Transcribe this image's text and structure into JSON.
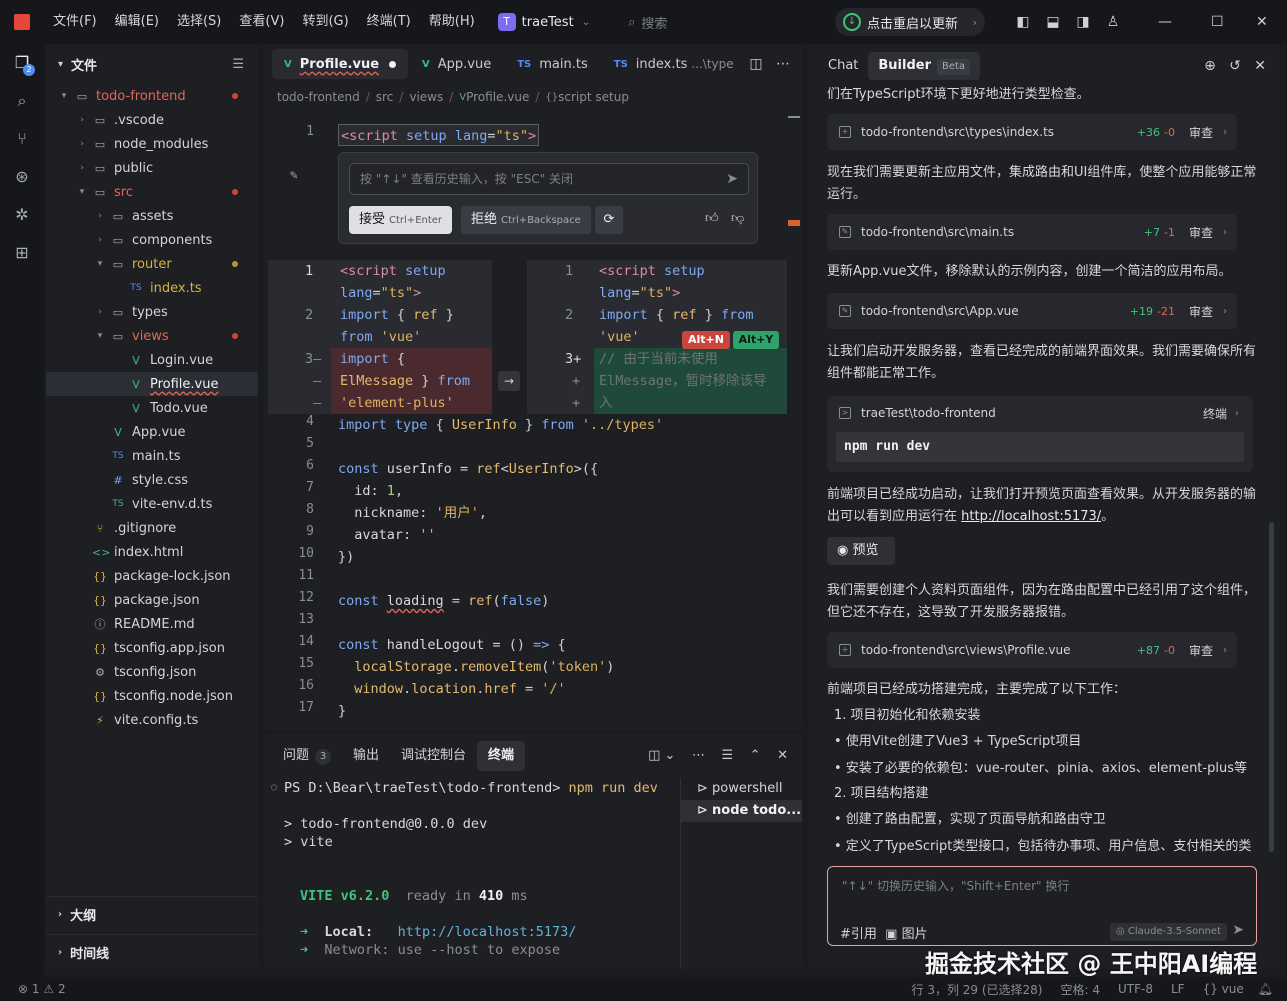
{
  "titlebar": {
    "menu": [
      "文件(F)",
      "编辑(E)",
      "选择(S)",
      "查看(V)",
      "转到(G)",
      "终端(T)",
      "帮助(H)"
    ],
    "project_badge": "T",
    "project_name": "traeTest",
    "search_placeholder": "搜索",
    "update_label": "点击重启以更新"
  },
  "activity": {
    "badge": "2"
  },
  "explorer": {
    "title": "文件",
    "tree": [
      {
        "label": "todo-frontend",
        "icon": "folder-open",
        "depth": 0,
        "tw": "▾",
        "color": "red",
        "dot": "#c9463d"
      },
      {
        "label": ".vscode",
        "icon": "folder",
        "depth": 1,
        "tw": "›"
      },
      {
        "label": "node_modules",
        "icon": "folder",
        "depth": 1,
        "tw": "›"
      },
      {
        "label": "public",
        "icon": "folder",
        "depth": 1,
        "tw": "›"
      },
      {
        "label": "src",
        "icon": "folder-open",
        "depth": 1,
        "tw": "▾",
        "color": "red",
        "dot": "#c9463d"
      },
      {
        "label": "assets",
        "icon": "folder",
        "depth": 2,
        "tw": "›"
      },
      {
        "label": "components",
        "icon": "folder",
        "depth": 2,
        "tw": "›"
      },
      {
        "label": "router",
        "icon": "folder-open",
        "depth": 2,
        "tw": "▾",
        "color": "yellow",
        "dot": "#b89a32"
      },
      {
        "label": "index.ts",
        "icon": "ts",
        "depth": 3,
        "tw": "",
        "color": "yellow"
      },
      {
        "label": "types",
        "icon": "folder",
        "depth": 2,
        "tw": "›"
      },
      {
        "label": "views",
        "icon": "folder-open",
        "depth": 2,
        "tw": "▾",
        "color": "red",
        "dot": "#c9463d"
      },
      {
        "label": "Login.vue",
        "icon": "vue",
        "depth": 3,
        "tw": ""
      },
      {
        "label": "Profile.vue",
        "icon": "vue",
        "depth": 3,
        "tw": "",
        "selected": true,
        "wavy": true
      },
      {
        "label": "Todo.vue",
        "icon": "vue",
        "depth": 3,
        "tw": ""
      },
      {
        "label": "App.vue",
        "icon": "vue",
        "depth": 2,
        "tw": ""
      },
      {
        "label": "main.ts",
        "icon": "ts",
        "depth": 2,
        "tw": ""
      },
      {
        "label": "style.css",
        "icon": "css",
        "depth": 2,
        "tw": ""
      },
      {
        "label": "vite-env.d.ts",
        "icon": "ts-green",
        "depth": 2,
        "tw": ""
      },
      {
        "label": ".gitignore",
        "icon": "git",
        "depth": 1,
        "tw": ""
      },
      {
        "label": "index.html",
        "icon": "html",
        "depth": 1,
        "tw": ""
      },
      {
        "label": "package-lock.json",
        "icon": "json",
        "depth": 1,
        "tw": ""
      },
      {
        "label": "package.json",
        "icon": "json",
        "depth": 1,
        "tw": ""
      },
      {
        "label": "README.md",
        "icon": "info",
        "depth": 1,
        "tw": ""
      },
      {
        "label": "tsconfig.app.json",
        "icon": "json",
        "depth": 1,
        "tw": ""
      },
      {
        "label": "tsconfig.json",
        "icon": "gear",
        "depth": 1,
        "tw": ""
      },
      {
        "label": "tsconfig.node.json",
        "icon": "json",
        "depth": 1,
        "tw": ""
      },
      {
        "label": "vite.config.ts",
        "icon": "vite",
        "depth": 1,
        "tw": ""
      }
    ],
    "outline_label": "大纲",
    "timeline_label": "时间线"
  },
  "editor": {
    "tabs": [
      {
        "label": "Profile.vue",
        "icon": "V",
        "kind": "vue",
        "active": true,
        "modified": true
      },
      {
        "label": "App.vue",
        "icon": "V",
        "kind": "vue"
      },
      {
        "label": "main.ts",
        "icon": "TS",
        "kind": "ts"
      },
      {
        "label": "index.ts",
        "icon": "TS",
        "kind": "ts",
        "sub": "...\\type"
      }
    ],
    "breadcrumb": [
      "todo-frontend",
      "src",
      "views",
      "Profile.vue",
      "script setup"
    ],
    "inline_chat": {
      "placeholder": "按 \"↑↓\" 查看历史输入，按 \"ESC\" 关闭",
      "accept_label": "接受",
      "accept_shortcut": "Ctrl+Enter",
      "reject_label": "拒绝",
      "reject_shortcut": "Ctrl+Backspace"
    },
    "shortcut_reject": "Alt+N",
    "shortcut_accept": "Alt+Y"
  },
  "terminal": {
    "tabs": [
      {
        "label": "问题",
        "count": "3"
      },
      {
        "label": "输出"
      },
      {
        "label": "调试控制台"
      },
      {
        "label": "终端",
        "active": true
      }
    ],
    "prompt": "PS D:\\Bear\\traeTest\\todo-frontend>",
    "command": "npm run dev",
    "out1": "> todo-frontend@0.0.0 dev",
    "out2": "> vite",
    "vite_name": "VITE v6.2.0",
    "vite_ready": "ready in",
    "vite_ms": "410",
    "vite_unit": "ms",
    "local_label": "Local:",
    "local_url": "http://localhost:5173/",
    "network_label": "Network:",
    "network_text": "use --host to expose",
    "sessions": [
      "powershell",
      "node todo..."
    ]
  },
  "chat": {
    "tab_chat": "Chat",
    "tab_builder": "Builder",
    "tab_beta": "Beta",
    "msg0": "们在TypeScript环境下更好地进行类型检查。",
    "card1": {
      "path": "todo-frontend\\src\\types\\index.ts",
      "add": "+36",
      "del": "-0",
      "review": "审查"
    },
    "msg1": "现在我们需要更新主应用文件，集成路由和UI组件库，使整个应用能够正常运行。",
    "card2": {
      "path": "todo-frontend\\src\\main.ts",
      "add": "+7",
      "del": "-1",
      "review": "审查"
    },
    "msg2": "更新App.vue文件，移除默认的示例内容，创建一个简洁的应用布局。",
    "card3": {
      "path": "todo-frontend\\src\\App.vue",
      "add": "+19",
      "del": "-21",
      "review": "审查"
    },
    "msg3": "让我们启动开发服务器，查看已经完成的前端界面效果。我们需要确保所有组件都能正常工作。",
    "cmd": {
      "path": "traeTest\\todo-frontend",
      "label": "终端",
      "command": "npm run dev"
    },
    "msg4a": "前端项目已经成功启动，让我们打开预览页面查看效果。从开发服务器的输出可以看到应用运行在 ",
    "msg4_link": "http://localhost:5173/",
    "msg4b": "。",
    "preview_label": "预览",
    "msg5": "我们需要创建个人资料页面组件，因为在路由配置中已经引用了这个组件，但它还不存在，这导致了开发服务器报错。",
    "card4": {
      "path": "todo-frontend\\src\\views\\Profile.vue",
      "add": "+87",
      "del": "-0",
      "review": "审查"
    },
    "msg6": "前端项目已经成功搭建完成，主要完成了以下工作：",
    "list": [
      "1. 项目初始化和依赖安装",
      "• 使用Vite创建了Vue3 + TypeScript项目",
      "• 安装了必要的依赖包：vue-router、pinia、axios、element-plus等",
      "2. 项目结构搭建",
      "• 创建了路由配置，实现了页面导航和路由守卫",
      "• 定义了TypeScript类型接口，包括待办事项、用户信息、支付相关的类"
    ],
    "input_placeholder": "\"↑↓\" 切换历史输入，\"Shift+Enter\" 换行",
    "ref_label": "#引用",
    "image_label": "图片",
    "model_label": "Claude-3.5-Sonnet"
  },
  "watermark": "掘金技术社区 @ 王中阳AI编程",
  "status": {
    "errors": "1",
    "warnings": "2",
    "cursor": "行 3，列 29 (已选择28)",
    "spaces": "空格: 4",
    "encoding": "UTF-8",
    "eol": "LF",
    "lang": "vue"
  }
}
